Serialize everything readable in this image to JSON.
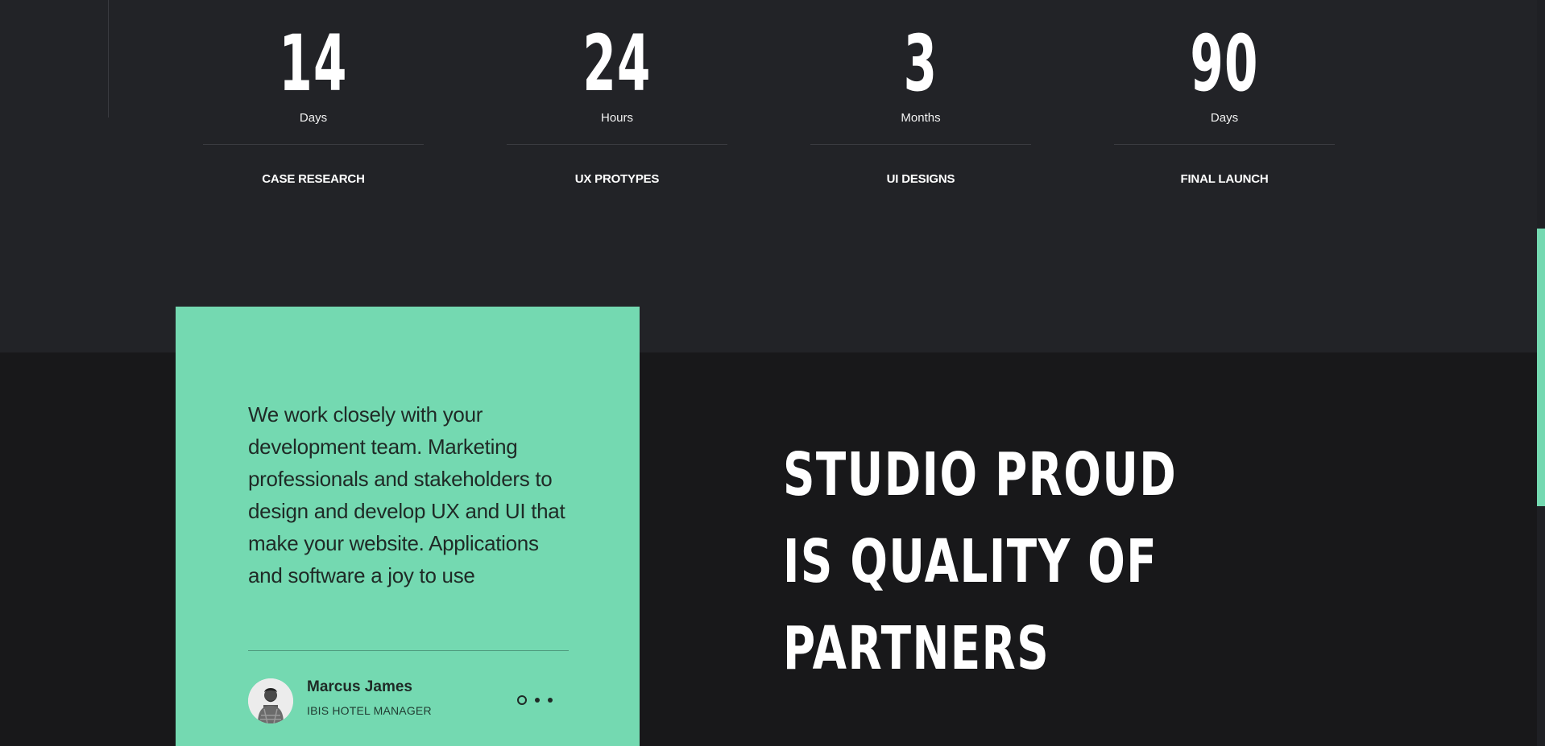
{
  "stats": [
    {
      "number": "14",
      "unit": "Days",
      "label": "CASE RESEARCH"
    },
    {
      "number": "24",
      "unit": "Hours",
      "label": "UX PROTYPES"
    },
    {
      "number": "3",
      "unit": "Months",
      "label": "UI DESIGNS"
    },
    {
      "number": "90",
      "unit": "Days",
      "label": "FINAL LAUNCH"
    }
  ],
  "testimonial": {
    "text": "We work closely with your development team. Marketing professionals and stakeholders to design and develop UX and UI that make your website. Applications and software a joy to use",
    "author_name": "Marcus James",
    "author_role": "IBIS HOTEL MANAGER",
    "avatar_icon": "person-avatar-icon",
    "slide_count": 3,
    "active_slide": 1
  },
  "headline": {
    "line1": "STUDIO PROUD",
    "line2": "IS QUALITY OF",
    "line3": "PARTNERS"
  },
  "colors": {
    "accent": "#74d9b1",
    "top_background": "#222327",
    "bottom_background": "#18181a",
    "text_light": "#ffffff",
    "text_dark": "#1f2a26"
  }
}
